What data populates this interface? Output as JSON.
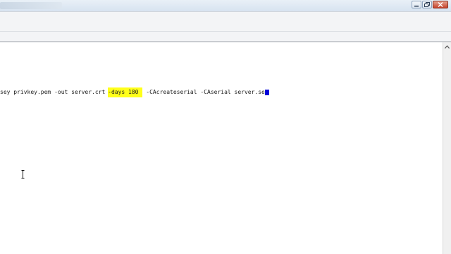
{
  "editor": {
    "line_before": "sey privkey.pem -out server.crt ",
    "line_highlight": "-days 180",
    "line_after": " -CAcreateserial -CAserial server.se"
  },
  "colors": {
    "highlight": "#ffff1a",
    "cursor": "#0000d8"
  },
  "icons": [
    "minimize-icon",
    "restore-icon",
    "close-icon",
    "scroll-up-arrow-icon",
    "text-cursor-icon"
  ]
}
